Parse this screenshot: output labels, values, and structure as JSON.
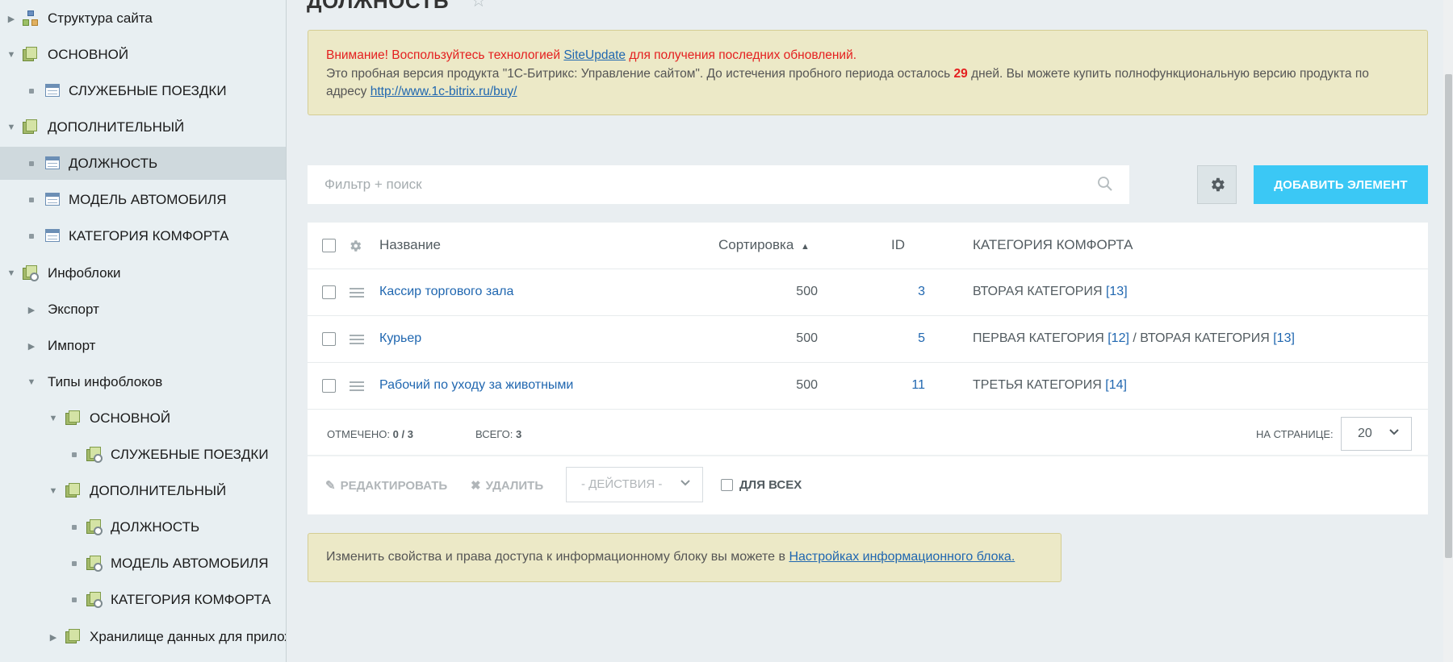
{
  "page": {
    "title": "ДОЛЖНОСТЬ"
  },
  "sidebar": {
    "items": [
      {
        "label": "Структура сайта"
      },
      {
        "label": "ОСНОВНОЙ"
      },
      {
        "label": "СЛУЖЕБНЫЕ ПОЕЗДКИ"
      },
      {
        "label": "ДОПОЛНИТЕЛЬНЫЙ"
      },
      {
        "label": "ДОЛЖНОСТЬ"
      },
      {
        "label": "МОДЕЛЬ АВТОМОБИЛЯ"
      },
      {
        "label": "КАТЕГОРИЯ КОМФОРТА"
      },
      {
        "label": "Инфоблоки"
      },
      {
        "label": "Экспорт"
      },
      {
        "label": "Импорт"
      },
      {
        "label": "Типы инфоблоков"
      },
      {
        "label": "ОСНОВНОЙ"
      },
      {
        "label": "СЛУЖЕБНЫЕ ПОЕЗДКИ"
      },
      {
        "label": "ДОПОЛНИТЕЛЬНЫЙ"
      },
      {
        "label": "ДОЛЖНОСТЬ"
      },
      {
        "label": "МОДЕЛЬ АВТОМОБИЛЯ"
      },
      {
        "label": "КАТЕГОРИЯ КОМФОРТА"
      },
      {
        "label": "Хранилище данных для прилож"
      }
    ]
  },
  "notice": {
    "warn_prefix": "Внимание! Воспользуйтесь технологией",
    "link": "SiteUpdate",
    "warn_suffix": "для получения последних обновлений.",
    "trial_text": "Это пробная версия продукта \"1С-Битрикс: Управление сайтом\". До истечения пробного периода осталось",
    "days": "29",
    "trial_text2": "дней. Вы можете купить полнофункциональную версию продукта по адресу",
    "buy_link": "http://www.1c-bitrix.ru/buy/"
  },
  "toolbar": {
    "filter_placeholder": "Фильтр + поиск",
    "add_button": "ДОБАВИТЬ ЭЛЕМЕНТ"
  },
  "grid": {
    "columns": {
      "name": "Название",
      "sort": "Сортировка",
      "id": "ID",
      "category": "КАТЕГОРИЯ КОМФОРТА"
    },
    "rows": [
      {
        "name": "Кассир торгового зала",
        "sort": "500",
        "id": "3",
        "cat1": "ВТОРАЯ КАТЕГОРИЯ",
        "cat1_id": "[13]",
        "sep": "",
        "cat2": "",
        "cat2_id": ""
      },
      {
        "name": "Курьер",
        "sort": "500",
        "id": "5",
        "cat1": "ПЕРВАЯ КАТЕГОРИЯ",
        "cat1_id": "[12]",
        "sep": "/",
        "cat2": "ВТОРАЯ КАТЕГОРИЯ",
        "cat2_id": "[13]"
      },
      {
        "name": "Рабочий по уходу за животными",
        "sort": "500",
        "id": "11",
        "cat1": "ТРЕТЬЯ КАТЕГОРИЯ",
        "cat1_id": "[14]",
        "sep": "",
        "cat2": "",
        "cat2_id": ""
      }
    ],
    "footer": {
      "checked_label": "ОТМЕЧЕНО:",
      "checked_value": "0 / 3",
      "total_label": "ВСЕГО:",
      "total_value": "3",
      "per_page_label": "НА СТРАНИЦЕ:",
      "per_page_value": "20"
    },
    "actions": {
      "edit": "РЕДАКТИРОВАТЬ",
      "delete": "УДАЛИТЬ",
      "select": "- ДЕЙСТВИЯ -",
      "for_all": "ДЛЯ ВСЕХ"
    }
  },
  "info": {
    "text": "Изменить свойства и права доступа к информационному блоку вы можете в",
    "link": "Настройках информационного блока."
  },
  "colors": {
    "accent": "#3bc8f5",
    "link": "#2067b0",
    "warning": "#e41f1f",
    "notice_bg": "#ece9c7"
  }
}
